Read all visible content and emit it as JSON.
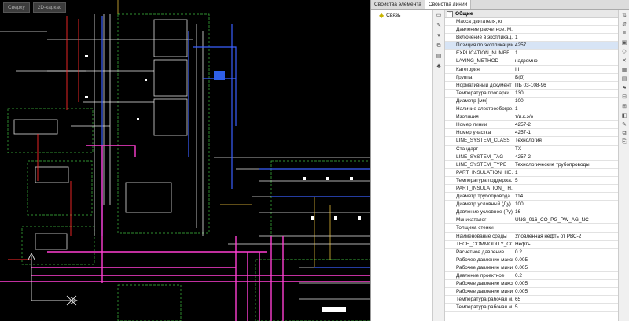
{
  "cad": {
    "tabs": [
      "Сверху",
      "2D-каркас"
    ]
  },
  "panel": {
    "tabs": [
      "Свойства элемента",
      "Свойства линии"
    ],
    "active_tab": 1,
    "tree_item": "Связь",
    "group": "Общие",
    "properties": [
      {
        "name": "Масса двигателя, кг",
        "value": ""
      },
      {
        "name": "Давление расчетное, М...",
        "value": ""
      },
      {
        "name": "Включение в экспликац...",
        "value": "1"
      },
      {
        "name": "Позиция по экспликации",
        "value": "4257"
      },
      {
        "name": "EXPLICATION_NUMBE...",
        "value": "1"
      },
      {
        "name": "LAYING_METHOD",
        "value": "надземно"
      },
      {
        "name": "Категория",
        "value": "III"
      },
      {
        "name": "Группа",
        "value": "Б(б)"
      },
      {
        "name": "Нормативный документ",
        "value": "ПБ 03-108-96"
      },
      {
        "name": "Температура пропарки",
        "value": "130"
      },
      {
        "name": "Диаметр [мм]",
        "value": "100"
      },
      {
        "name": "Наличие электрообогре...",
        "value": "1"
      },
      {
        "name": "Изоляция",
        "value": "т/и.к.э/о"
      },
      {
        "name": "Номер линии",
        "value": "4257-2"
      },
      {
        "name": "Номер участка",
        "value": "4257-1"
      },
      {
        "name": "LINE_SYSTEM_CLASS",
        "value": "Технология"
      },
      {
        "name": "Стандарт",
        "value": "ТХ"
      },
      {
        "name": "LINE_SYSTEM_TAG",
        "value": "4257-2"
      },
      {
        "name": "LINE_SYSTEM_TYPE",
        "value": "Технологические трубопроводы"
      },
      {
        "name": "PART_INSULATION_HE...",
        "value": "1"
      },
      {
        "name": "Температура поддержа...",
        "value": "5"
      },
      {
        "name": "PART_INSULATION_TH...",
        "value": ""
      },
      {
        "name": "Диаметр трубопровода",
        "value": "114"
      },
      {
        "name": "Диаметр условный (Ду)",
        "value": "100"
      },
      {
        "name": "Давление условное (Ру)",
        "value": "16"
      },
      {
        "name": "Миникаталог",
        "value": "UNG_016_CO_PG_PW_AG_NC"
      },
      {
        "name": "Толщина стенки",
        "value": ""
      },
      {
        "name": "Наименование среды",
        "value": "Уловленная нефть от РВС-2"
      },
      {
        "name": "TECH_COMMODITY_CO...",
        "value": "Нефть"
      },
      {
        "name": "Расчетное давление",
        "value": "0.2"
      },
      {
        "name": "Рабочее давление макси...",
        "value": "0.005"
      },
      {
        "name": "Рабочее давление мини...",
        "value": "0.005"
      },
      {
        "name": "Давление проектное",
        "value": "0.2"
      },
      {
        "name": "Рабочее давление макси...",
        "value": "0.005"
      },
      {
        "name": "Рабочее давление мини...",
        "value": "0.005"
      },
      {
        "name": "Температура рабочая м...",
        "value": "65"
      },
      {
        "name": "Температура рабочая м...",
        "value": "5"
      }
    ]
  }
}
